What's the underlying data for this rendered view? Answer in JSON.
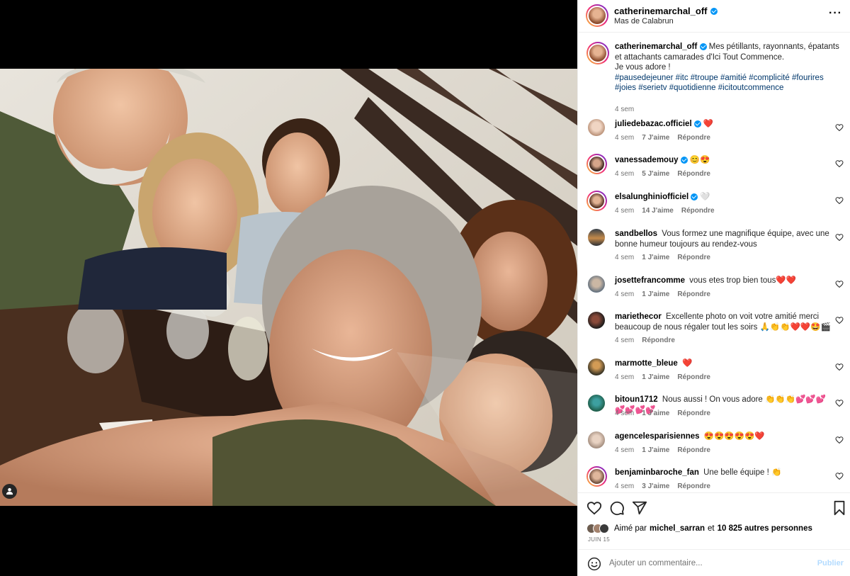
{
  "colors": {
    "link": "#00376b",
    "muted": "#737373",
    "verified": "#0095f6",
    "publish_disabled": "#b3dbff",
    "heart_red": "#ed4956"
  },
  "photo": {
    "alt_icon": "person-tag-icon"
  },
  "header": {
    "username": "catherinemarchal_off",
    "location": "Mas de Calabrun",
    "more": "···"
  },
  "caption": {
    "username": "catherinemarchal_off",
    "text_line1": "Mes pétillants, rayonnants, épatants et attachants camarades d'Ici Tout Commence.",
    "text_line2": "Je vous adore !",
    "hashtags": "#pausedejeuner #itc #troupe #amitié #complicité #fourires #joies #serietv #quotidienne #icitoutcommence",
    "time": "4 sem"
  },
  "comments": [
    {
      "user": "juliedebazac.officiel",
      "verified": true,
      "text": "❤️",
      "time": "4 sem",
      "likes": "7 J'aime",
      "reply": "Répondre"
    },
    {
      "user": "vanessademouy",
      "verified": true,
      "text": "😊😍",
      "time": "4 sem",
      "likes": "5 J'aime",
      "reply": "Répondre"
    },
    {
      "user": "elsalunghiniofficiel",
      "verified": true,
      "text": "🤍",
      "time": "4 sem",
      "likes": "14 J'aime",
      "reply": "Répondre"
    },
    {
      "user": "sandbellos",
      "verified": false,
      "text": "Vous formez une magnifique équipe, avec une bonne humeur toujours au rendez-vous",
      "time": "4 sem",
      "likes": "1 J'aime",
      "reply": "Répondre"
    },
    {
      "user": "josettefrancomme",
      "verified": false,
      "text": "vous etes trop bien tous❤️❤️",
      "time": "4 sem",
      "likes": "1 J'aime",
      "reply": "Répondre"
    },
    {
      "user": "mariethecor",
      "verified": false,
      "text": "Excellente photo on voit votre amitié merci beaucoup de nous régaler tout les soirs 🙏👏👏❤️❤️🤩🎬",
      "time": "4 sem",
      "likes": "",
      "reply": "Répondre"
    },
    {
      "user": "marmotte_bleue",
      "verified": false,
      "text": "❤️",
      "time": "4 sem",
      "likes": "1 J'aime",
      "reply": "Répondre"
    },
    {
      "user": "bitoun1712",
      "verified": false,
      "text": "Nous aussi ! On vous adore 👏👏👏💕💕💕💕💕💕💕",
      "time": "4 sem",
      "likes": "1 J'aime",
      "reply": "Répondre"
    },
    {
      "user": "agencelesparisiennes",
      "verified": false,
      "text": "😍😍😍😍😍❤️",
      "time": "4 sem",
      "likes": "1 J'aime",
      "reply": "Répondre"
    },
    {
      "user": "benjaminbaroche_fan",
      "verified": false,
      "text": "Une belle équipe ! 👏",
      "time": "4 sem",
      "likes": "3 J'aime",
      "reply": "Répondre"
    }
  ],
  "actions": {
    "like_icon": "heart-icon",
    "comment_icon": "comment-icon",
    "share_icon": "send-icon",
    "save_icon": "bookmark-icon"
  },
  "likes": {
    "prefix": "Aimé par",
    "user": "michel_sarran",
    "connector": "et",
    "others": "10 825 autres personnes"
  },
  "date": "JUIN 15",
  "add_comment": {
    "placeholder": "Ajouter un commentaire...",
    "publish": "Publier"
  }
}
